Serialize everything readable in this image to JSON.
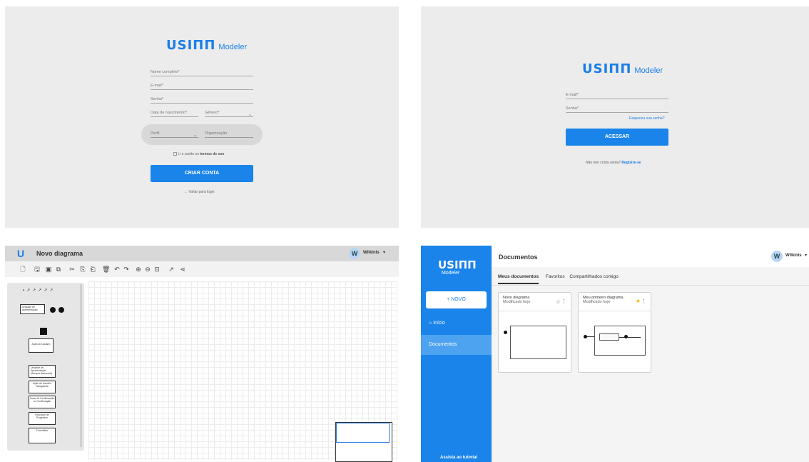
{
  "signup": {
    "logo_mark": "USIΠΠ",
    "logo_text": "Modeler",
    "full_name_placeholder": "Nome completo*",
    "email_placeholder": "E-mail*",
    "password_placeholder": "Senha*",
    "birthdate_placeholder": "Data de nascimento*",
    "gender_placeholder": "Gênero*",
    "profile_placeholder": "Perfil",
    "organization_placeholder": "Organização",
    "terms_prefix": "Li e aceito os ",
    "terms_link": "termos de uso",
    "create_button": "CRIAR CONTA",
    "back_to_login": "← Voltar para login"
  },
  "login": {
    "logo_mark": "USIΠΠ",
    "logo_text": "Modeler",
    "email_placeholder": "E-mail*",
    "password_placeholder": "Senha*",
    "forgot": "Esqueceu sua senha?",
    "access_button": "ACESSAR",
    "no_account": "Não tem conta ainda? ",
    "register": "Registre-se"
  },
  "editor": {
    "title": "Novo diagrama",
    "user_initial": "W",
    "user_name": "Wilkinis",
    "palette_shapes": [
      "Unidade de Apresentação",
      "Ação do Usuário",
      "Unidade de Apresentação (Sempre Acessível)",
      "Ação do Usuário Obrigatória",
      "Ícone de Confirmação ou Confirmação",
      "Indicador de Progresso",
      "Formulário"
    ]
  },
  "documents": {
    "logo_mark": "USIΠΠ",
    "logo_text": "Modeler",
    "new_button": "+ NOVO",
    "nav_home": "Início",
    "nav_documents": "Documentos",
    "tutorial": "Assista ao tutorial",
    "page_title": "Documentos",
    "user_initial": "W",
    "user_name": "Wilkinis",
    "tabs": [
      "Meus documentos",
      "Favoritos",
      "Compartilhados comigo"
    ],
    "cards": [
      {
        "title": "Novo diagrama",
        "subtitle": "Modificado hoje",
        "favorite": false
      },
      {
        "title": "Meu primeiro diagrama",
        "subtitle": "Modificado hoje",
        "favorite": true
      }
    ]
  },
  "colors": {
    "accent": "#1a84ea",
    "star": "#f5b800"
  }
}
